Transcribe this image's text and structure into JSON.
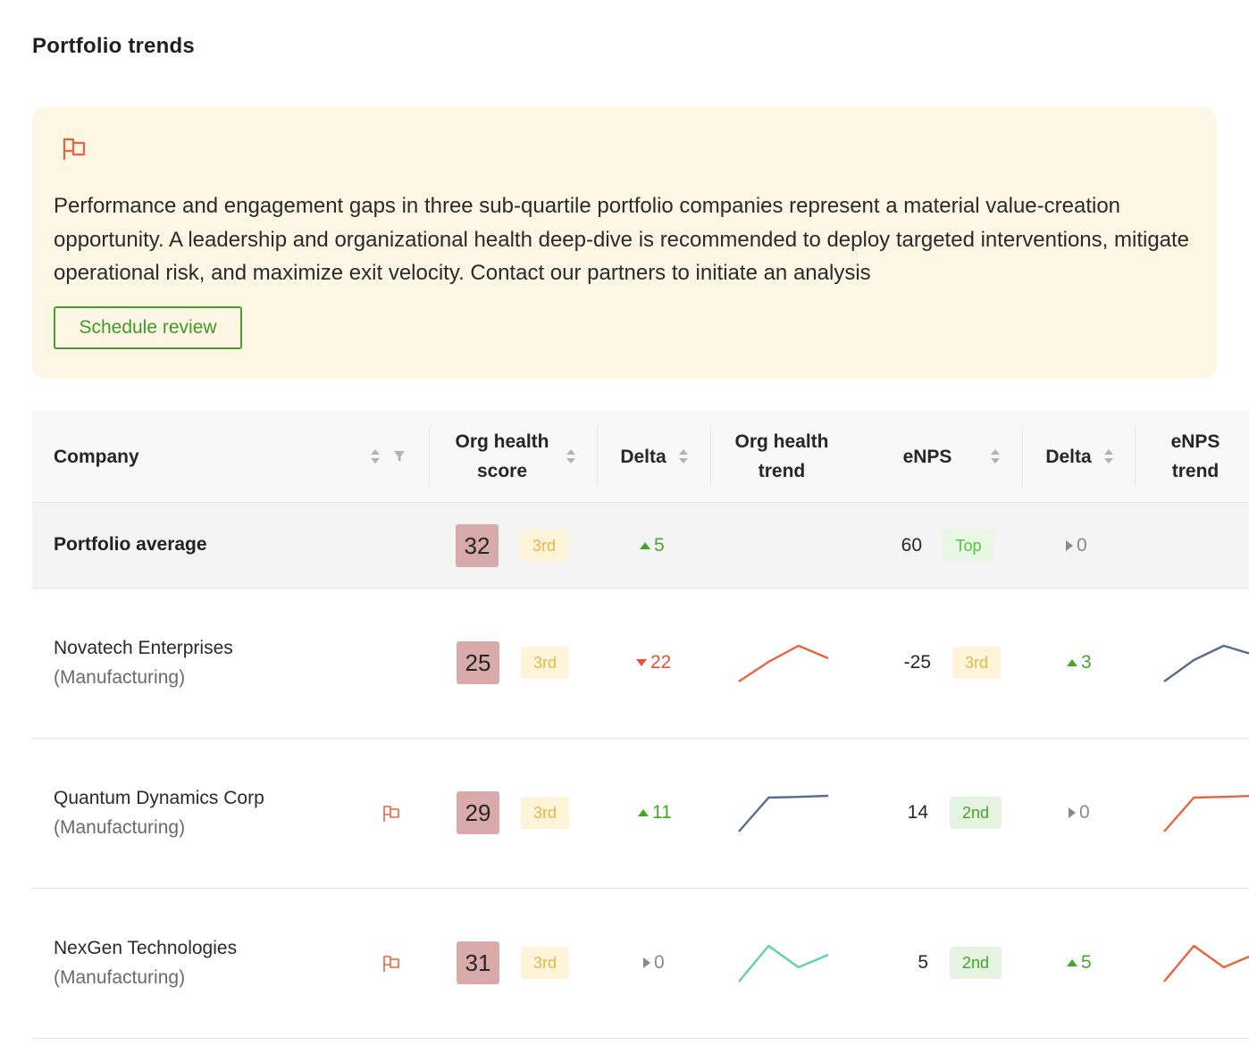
{
  "page": {
    "title": "Portfolio trends"
  },
  "banner": {
    "icon": "flag-icon",
    "message": "Performance and engagement gaps in three sub-quartile portfolio companies represent a material value-creation opportunity. A leadership and organizational health deep-dive is recommended to deploy targeted interventions, mitigate operational risk, and maximize exit velocity. Contact our partners to initiate an analysis",
    "button_label": "Schedule review"
  },
  "colors": {
    "alert": "#e8643f",
    "accent_green": "#46a12c",
    "banner_bg": "#fdf6e4",
    "score_bg": "#d9aaaa",
    "trend_red": "#e8643f",
    "trend_slate": "#596b8c",
    "trend_teal": "#5fd3a8"
  },
  "table": {
    "headers": {
      "company": "Company",
      "org_health_score_line1": "Org health",
      "org_health_score_line2": "score",
      "delta": "Delta",
      "org_health_trend_line1": "Org health",
      "org_health_trend_line2": "trend",
      "enps": "eNPS",
      "enps_delta": "Delta",
      "enps_trend_line1": "eNPS",
      "enps_trend_line2": "trend"
    },
    "average": {
      "label": "Portfolio average",
      "score": "32",
      "score_quartile": "3rd",
      "delta": "5",
      "delta_dir": "up",
      "enps": "60",
      "enps_quartile": "Top",
      "enps_delta": "0",
      "enps_delta_dir": "flat"
    },
    "rows": [
      {
        "name": "Novatech Enterprises",
        "industry": "(Manufacturing)",
        "flagged": false,
        "score": "25",
        "score_quartile": "3rd",
        "delta": "22",
        "delta_dir": "down",
        "org_trend": {
          "color": "#e8643f",
          "values": [
            0.0,
            0.55,
            1.0,
            0.65
          ]
        },
        "enps": "-25",
        "enps_quartile": "3rd",
        "enps_delta": "3",
        "enps_delta_dir": "up",
        "enps_trend": {
          "color": "#596b8c",
          "values": [
            0.0,
            0.6,
            1.0,
            0.75
          ]
        }
      },
      {
        "name": "Quantum Dynamics Corp",
        "industry": "(Manufacturing)",
        "flagged": true,
        "score": "29",
        "score_quartile": "3rd",
        "delta": "11",
        "delta_dir": "up",
        "org_trend": {
          "color": "#596b8c",
          "values": [
            0.0,
            0.95,
            0.97,
            1.0
          ]
        },
        "enps": "14",
        "enps_quartile": "2nd",
        "enps_delta": "0",
        "enps_delta_dir": "flat",
        "enps_trend": {
          "color": "#e8643f",
          "values": [
            0.0,
            0.95,
            0.97,
            1.0
          ]
        }
      },
      {
        "name": "NexGen Technologies",
        "industry": "(Manufacturing)",
        "flagged": true,
        "score": "31",
        "score_quartile": "3rd",
        "delta": "0",
        "delta_dir": "flat",
        "org_trend": {
          "color": "#5fd3a8",
          "values": [
            0.0,
            1.0,
            0.4,
            0.75
          ]
        },
        "enps": "5",
        "enps_quartile": "2nd",
        "enps_delta": "5",
        "enps_delta_dir": "up",
        "enps_trend": {
          "color": "#e8643f",
          "values": [
            0.0,
            1.0,
            0.4,
            0.75
          ]
        }
      }
    ]
  }
}
